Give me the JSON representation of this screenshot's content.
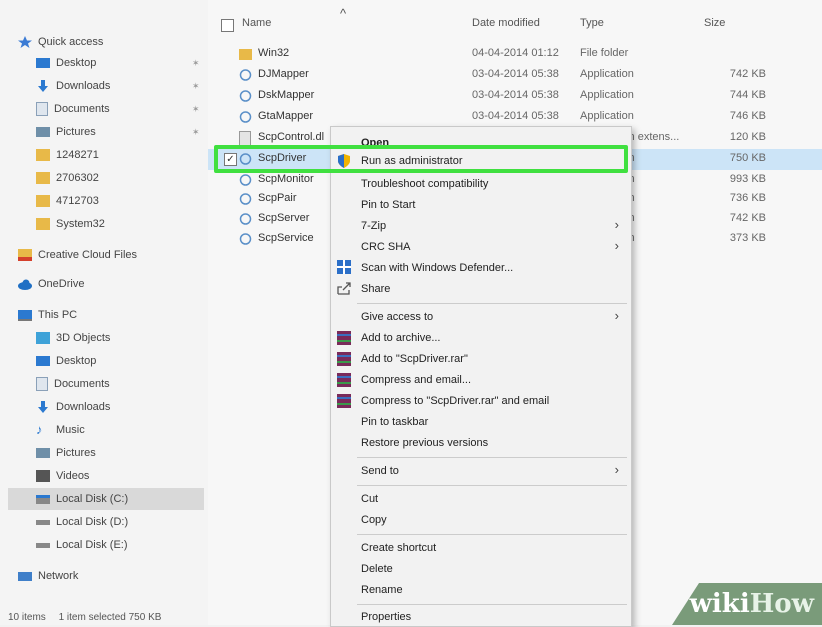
{
  "colors": {
    "highlight": "#40e040",
    "selection": "#cce4f7",
    "watermark_bg": "#7a9b7a"
  },
  "sidebar": {
    "items": [
      {
        "label": "Quick access",
        "icon": "star-icon"
      },
      {
        "label": "Desktop",
        "icon": "desktop-icon"
      },
      {
        "label": "Downloads",
        "icon": "download-icon"
      },
      {
        "label": "Documents",
        "icon": "document-icon"
      },
      {
        "label": "Pictures",
        "icon": "pictures-icon"
      },
      {
        "label": "1248271",
        "icon": "folder-icon"
      },
      {
        "label": "2706302",
        "icon": "folder-icon"
      },
      {
        "label": "4712703",
        "icon": "folder-icon"
      },
      {
        "label": "System32",
        "icon": "folder-icon"
      },
      {
        "label": "Creative Cloud Files",
        "icon": "creative-cloud-icon"
      },
      {
        "label": "OneDrive",
        "icon": "cloud-icon"
      },
      {
        "label": "This PC",
        "icon": "computer-icon"
      },
      {
        "label": "3D Objects",
        "icon": "cube-icon"
      },
      {
        "label": "Desktop",
        "icon": "desktop-icon"
      },
      {
        "label": "Documents",
        "icon": "document-icon"
      },
      {
        "label": "Downloads",
        "icon": "download-icon"
      },
      {
        "label": "Music",
        "icon": "music-icon"
      },
      {
        "label": "Pictures",
        "icon": "pictures-icon"
      },
      {
        "label": "Videos",
        "icon": "video-icon"
      },
      {
        "label": "Local Disk (C:)",
        "icon": "disk-icon"
      },
      {
        "label": "Local Disk (D:)",
        "icon": "disk-icon"
      },
      {
        "label": "Local Disk (E:)",
        "icon": "disk-icon"
      },
      {
        "label": "Network",
        "icon": "network-icon"
      }
    ]
  },
  "status": {
    "items": "10 items",
    "selected": "1 item selected  750 KB"
  },
  "columns": {
    "name": "Name",
    "date": "Date modified",
    "type": "Type",
    "size": "Size"
  },
  "files": [
    {
      "name": "Win32",
      "date": "04-04-2014 01:12",
      "type": "File folder",
      "size": ""
    },
    {
      "name": "DJMapper",
      "date": "03-04-2014 05:38",
      "type": "Application",
      "size": "742 KB"
    },
    {
      "name": "DskMapper",
      "date": "03-04-2014 05:38",
      "type": "Application",
      "size": "744 KB"
    },
    {
      "name": "GtaMapper",
      "date": "03-04-2014 05:38",
      "type": "Application",
      "size": "746 KB"
    },
    {
      "name": "ScpControl.dl",
      "date": "",
      "type": "ion extens...",
      "size": "120 KB"
    },
    {
      "name": "ScpDriver",
      "date": "",
      "type": "ion",
      "size": "750 KB"
    },
    {
      "name": "ScpMonitor",
      "date": "",
      "type": "ion",
      "size": "993 KB"
    },
    {
      "name": "ScpPair",
      "date": "",
      "type": "ion",
      "size": "736 KB"
    },
    {
      "name": "ScpServer",
      "date": "",
      "type": "ion",
      "size": "742 KB"
    },
    {
      "name": "ScpService",
      "date": "",
      "type": "ion",
      "size": "373 KB"
    }
  ],
  "menu": {
    "open": "Open",
    "run_as_admin": "Run as administrator",
    "troubleshoot": "Troubleshoot compatibility",
    "pin_start": "Pin to Start",
    "seven_zip": "7-Zip",
    "crc_sha": "CRC SHA",
    "scan_defender": "Scan with Windows Defender...",
    "share": "Share",
    "give_access": "Give access to",
    "add_archive": "Add to archive...",
    "add_rar": "Add to \"ScpDriver.rar\"",
    "compress_email": "Compress and email...",
    "compress_rar_email": "Compress to \"ScpDriver.rar\" and email",
    "pin_taskbar": "Pin to taskbar",
    "restore_versions": "Restore previous versions",
    "send_to": "Send to",
    "cut": "Cut",
    "copy": "Copy",
    "create_shortcut": "Create shortcut",
    "delete": "Delete",
    "rename": "Rename",
    "properties": "Properties",
    "submenu_arrow": "›"
  },
  "watermark": {
    "wiki": "wiki",
    "how": "How"
  }
}
